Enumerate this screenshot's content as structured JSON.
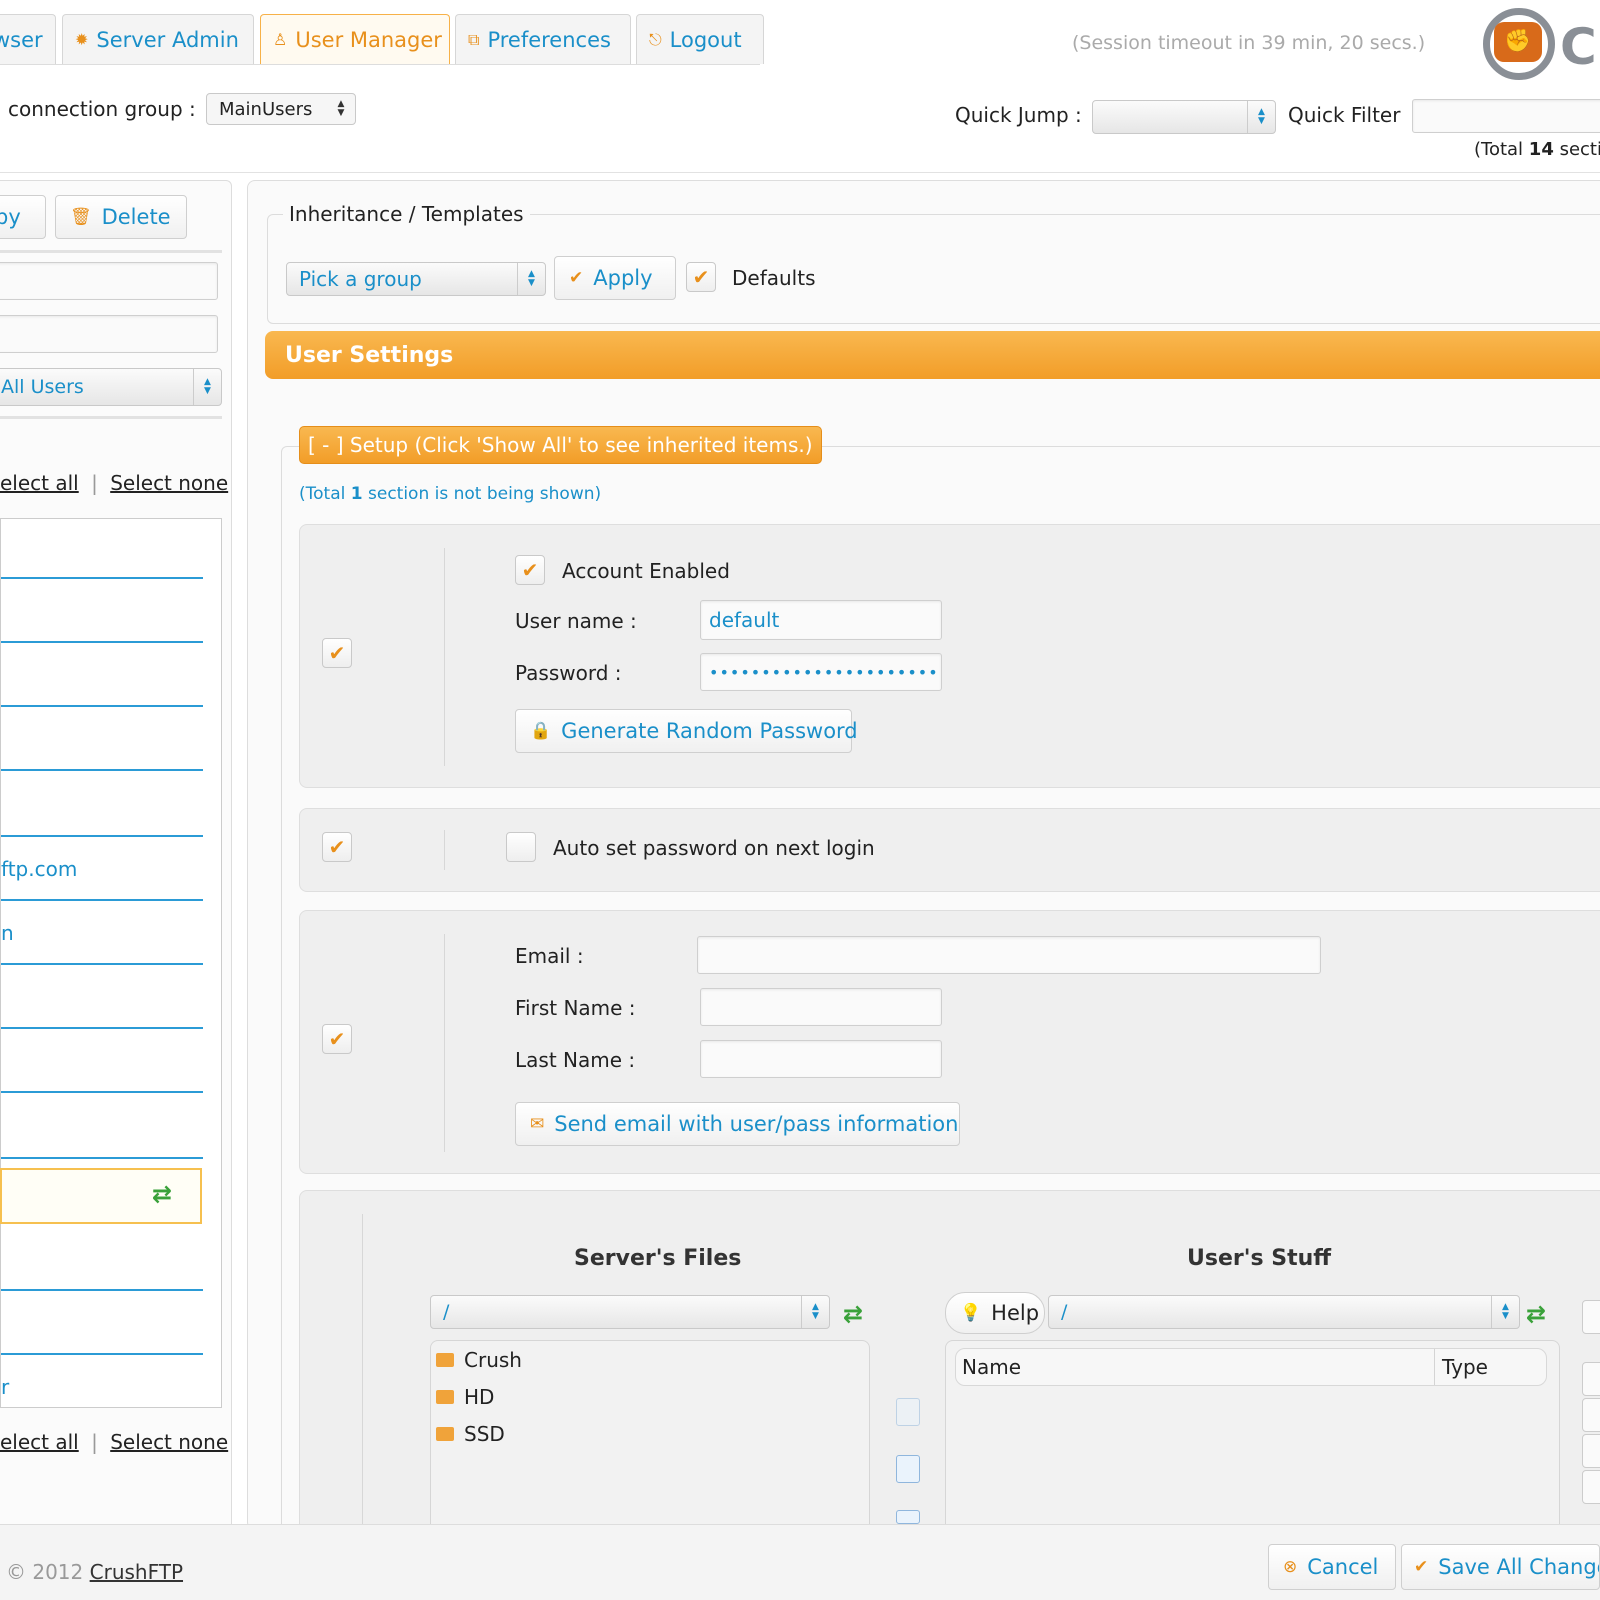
{
  "tabs": [
    {
      "label": "wser",
      "icon": "user-icon"
    },
    {
      "label": "Server Admin",
      "icon": "gear-icon"
    },
    {
      "label": "User Manager",
      "icon": "user-icon",
      "active": true
    },
    {
      "label": "Preferences",
      "icon": "preferences-icon"
    },
    {
      "label": "Logout",
      "icon": "logout-icon"
    }
  ],
  "session": {
    "timeout": "(Session timeout in 39 min, 20 secs.)"
  },
  "logo": {
    "letter": "C"
  },
  "connection_group": {
    "label": "connection group :",
    "value": "MainUsers"
  },
  "quick_jump": {
    "label": "Quick Jump :",
    "value": ""
  },
  "quick_filter": {
    "label": "Quick Filter",
    "value": ""
  },
  "total_sections": {
    "prefix": "(Total ",
    "count": "14",
    "suffix": " sectio"
  },
  "left": {
    "copy_label": "py",
    "delete_label": "Delete",
    "filter_select": "All Users",
    "select_all": "elect all",
    "separator": "|",
    "select_none": "Select none",
    "users": [
      "",
      "",
      "",
      "",
      "",
      "ftp.com",
      "n",
      "",
      "",
      "",
      "",
      "",
      "",
      "r"
    ]
  },
  "inheritance": {
    "legend": "Inheritance / Templates",
    "group_select": "Pick a group",
    "apply_label": "Apply",
    "defaults_label": "Defaults"
  },
  "user_settings": {
    "title": "User Settings"
  },
  "setup": {
    "tag": "[ - ] Setup (Click 'Show All' to see inherited items.)",
    "hidden_prefix": "(Total ",
    "hidden_count": "1",
    "hidden_suffix": " section is not being shown)"
  },
  "account": {
    "enabled_label": "Account Enabled",
    "username_label": "User name :",
    "username_value": "default",
    "password_label": "Password :",
    "password_value": "•••••••••••••••••••••••",
    "generate_label": "Generate Random Password"
  },
  "autoset": {
    "label": "Auto set password on next login"
  },
  "contact": {
    "email_label": "Email :",
    "first_label": "First Name :",
    "last_label": "Last Name :",
    "send_label": "Send email with user/pass information"
  },
  "files": {
    "server_title": "Server's Files",
    "user_title": "User's Stuff",
    "server_path": "/",
    "user_path": "/",
    "help_label": "Help",
    "folders": [
      "Crush",
      "HD",
      "SSD"
    ],
    "col_name": "Name",
    "col_type": "Type"
  },
  "footer": {
    "copyright": "© 2012 ",
    "brand": "CrushFTP",
    "cancel_label": "Cancel",
    "save_label": "Save All Change"
  },
  "colors": {
    "accent": "#f29d28",
    "link": "#1a8fc9"
  }
}
